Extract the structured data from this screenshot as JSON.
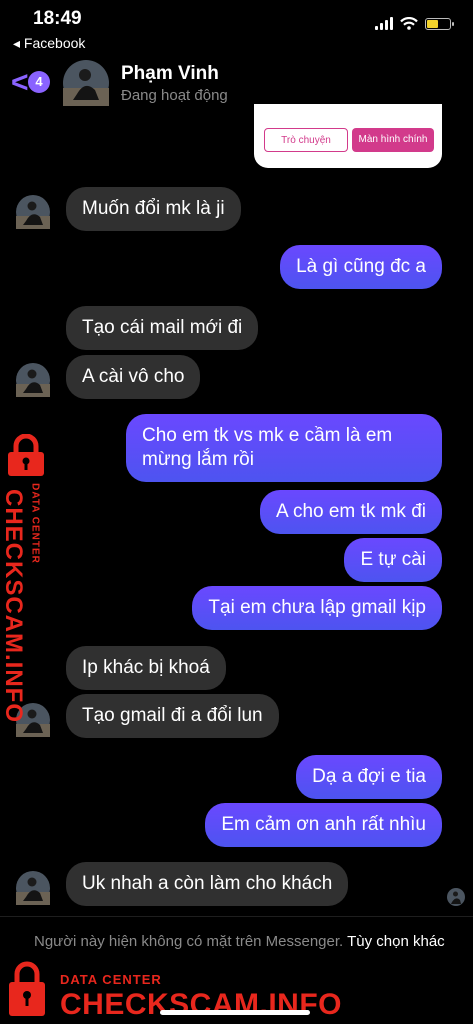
{
  "status_bar": {
    "time": "18:49",
    "back_app": "◂ Facebook"
  },
  "header": {
    "unread_count": "4",
    "contact_name": "Phạm Vinh",
    "contact_status": "Đang hoạt động",
    "back_icon": "chevron-left-icon"
  },
  "shared_image": {
    "button_left": "Trò chuyện",
    "button_right": "Màn hình chính"
  },
  "messages": [
    {
      "side": "in",
      "text": "Muốn đổi mk là ji"
    },
    {
      "side": "out",
      "text": "Là gì cũng đc a"
    },
    {
      "side": "in",
      "text": "Tạo cái mail mới đi"
    },
    {
      "side": "in",
      "text": "A cài vô cho"
    },
    {
      "side": "out",
      "text": "Cho em tk vs mk e cầm là em mừng lắm rồi"
    },
    {
      "side": "out",
      "text": "A cho em tk mk đi"
    },
    {
      "side": "out",
      "text": "E tự cài"
    },
    {
      "side": "out",
      "text": "Tại em chưa lập gmail kịp"
    },
    {
      "side": "in",
      "text": "Ip khác bị khoá"
    },
    {
      "side": "in",
      "text": "Tạo gmail đi a đổi lun"
    },
    {
      "side": "out",
      "text": "Dạ a đợi e tia"
    },
    {
      "side": "out",
      "text": "Em cảm ơn anh rất nhìu"
    },
    {
      "side": "in",
      "text": "Uk nhah a còn làm cho khách"
    }
  ],
  "footer": {
    "notice": "Người này hiện không có mặt trên Messenger.",
    "link": "Tùy chọn khác"
  },
  "watermark": {
    "small": "DATA CENTER",
    "big": "CHECKSCAM.INFO"
  },
  "colors": {
    "accent": "#8a63ff",
    "outgoing": "#5b4ff7",
    "incoming": "#303030",
    "watermark": "#e8271d"
  }
}
